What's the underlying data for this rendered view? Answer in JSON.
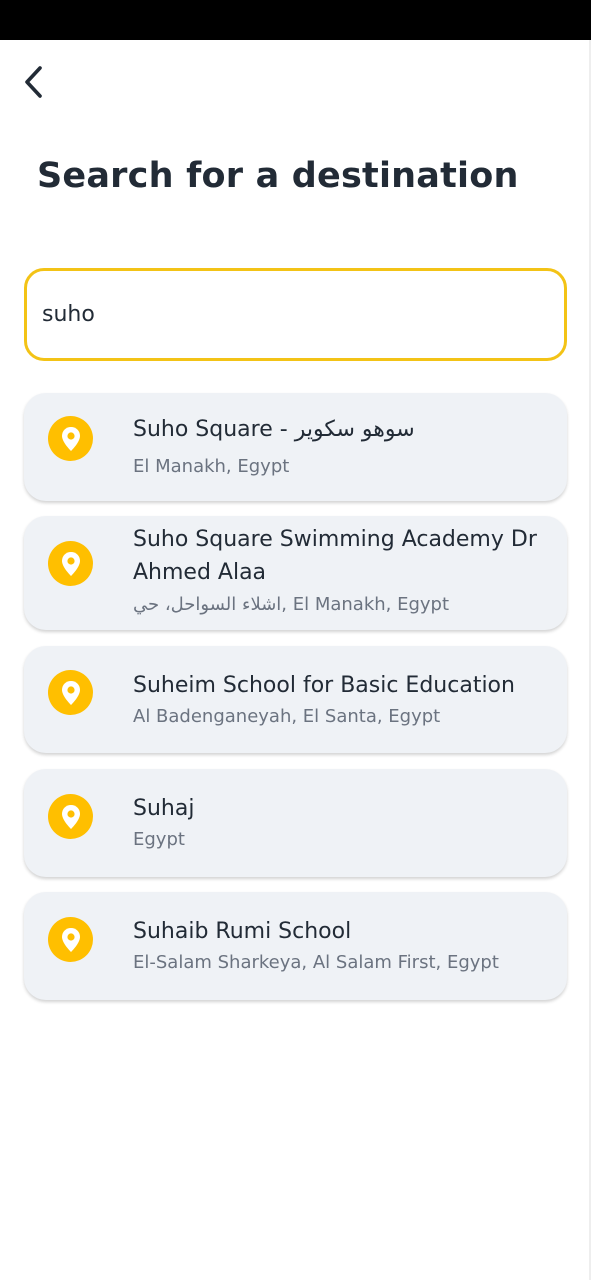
{
  "header": {
    "title": "Search for a destination"
  },
  "search": {
    "value": "suho"
  },
  "results": [
    {
      "title": "Suho Square - سوهو سكوير",
      "subtitle": "El Manakh, Egypt"
    },
    {
      "title": "Suho Square Swimming Academy Dr Ahmed Alaa",
      "subtitle": "اشلاء السواحل، حي, El Manakh, Egypt"
    },
    {
      "title": "Suheim School for Basic Education",
      "subtitle": "Al Badenganeyah, El Santa, Egypt"
    },
    {
      "title": "Suhaj",
      "subtitle": "Egypt"
    },
    {
      "title": "Suhaib Rumi School",
      "subtitle": "El-Salam Sharkeya, Al Salam First, Egypt"
    }
  ],
  "icons": {
    "back": "chevron-left-icon",
    "result": "location-pin-icon"
  },
  "colors": {
    "accent": "#f3c316",
    "pin": "#ffbf00",
    "card": "#eff2f6",
    "text": "#222b36",
    "muted": "#6b7380"
  }
}
